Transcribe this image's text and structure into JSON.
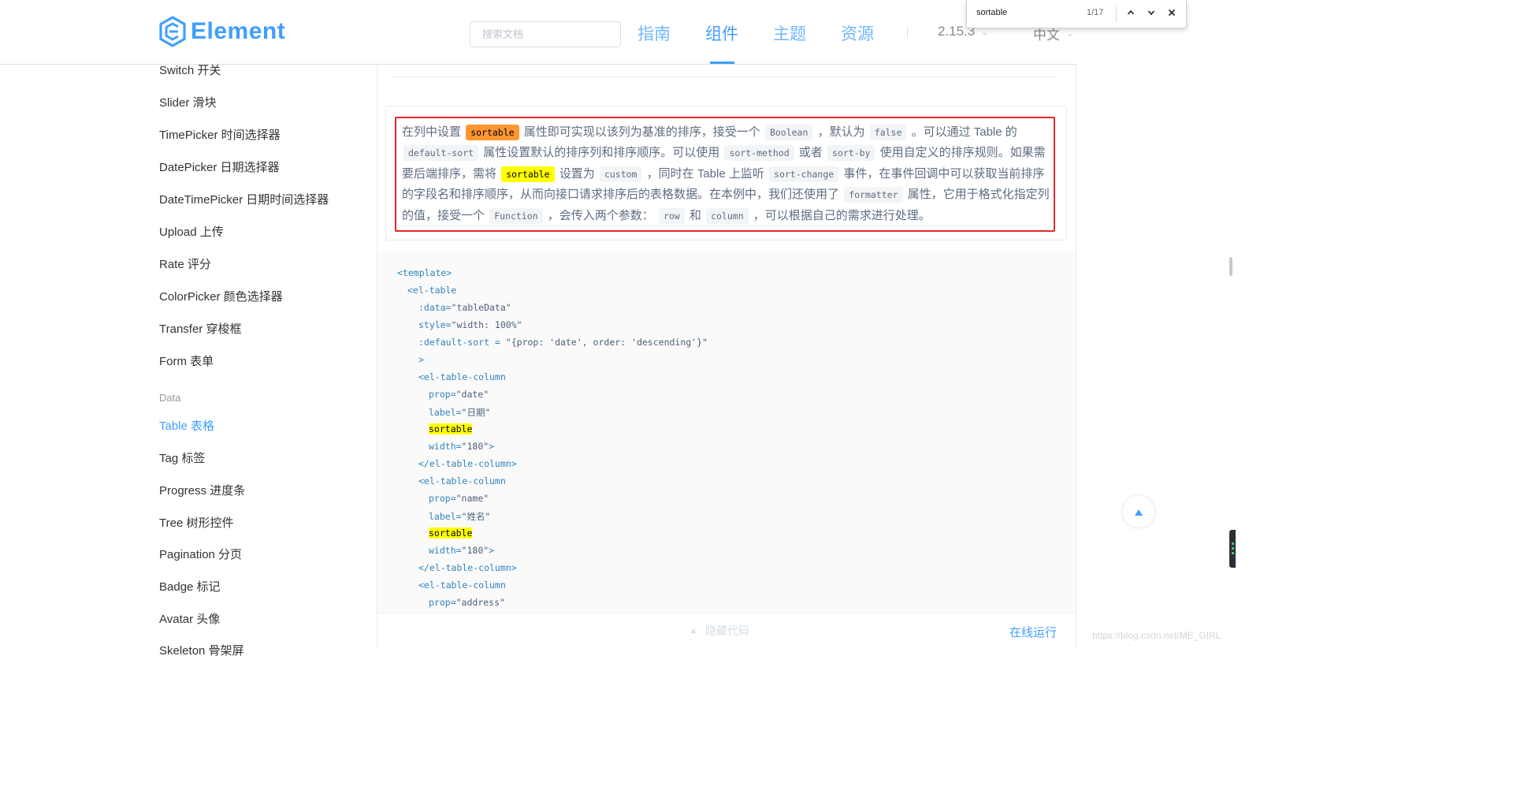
{
  "header": {
    "logo_text": "Element",
    "search_placeholder": "搜索文档",
    "nav": [
      "指南",
      "组件",
      "主题",
      "资源"
    ],
    "version": "2.15.3",
    "language": "中文"
  },
  "find_bar": {
    "query": "sortable",
    "count": "1/17"
  },
  "sidebar": {
    "items_top": [
      "Switch 开关",
      "Slider 滑块",
      "TimePicker 时间选择器",
      "DatePicker 日期选择器",
      "DateTimePicker 日期时间选择器",
      "Upload 上传",
      "Rate 评分",
      "ColorPicker 颜色选择器",
      "Transfer 穿梭框",
      "Form 表单"
    ],
    "group_label": "Data",
    "items_data": [
      "Table 表格",
      "Tag 标签",
      "Progress 进度条",
      "Tree 树形控件",
      "Pagination 分页",
      "Badge 标记",
      "Avatar 头像",
      "Skeleton 骨架屏"
    ],
    "active": "Table 表格"
  },
  "description": {
    "t1": "在列中设置",
    "c1": "sortable",
    "t2": "属性即可实现以该列为基准的排序，接受一个",
    "c2": "Boolean",
    "t3": "，默认为",
    "c3": "false",
    "t4": "。可以通过 Table 的",
    "c4": "default-sort",
    "t5": "属性设置默认的排序列和排序顺序。可以使用",
    "c5": "sort-method",
    "t6": "或者",
    "c6": "sort-by",
    "t7": "使用自定义的排序规则。如果需要后端排序，需将",
    "c7": "sortable",
    "t8": "设置为",
    "c8": "custom",
    "t9": "，同时在 Table 上监听",
    "c9": "sort-change",
    "t10": "事件，在事件回调中可以获取当前排序的字段名和排序顺序，从而向接口请求排序后的表格数据。在本例中，我们还使用了",
    "c10": "formatter",
    "t11": "属性，它用于格式化指定列的值，接受一个",
    "c11": "Function",
    "t12": "，会传入两个参数：",
    "c12": "row",
    "t13": "和",
    "c13": "column",
    "t14": "，可以根据自己的需求进行处理。"
  },
  "code": {
    "l1": "<template>",
    "l2": "<el-table",
    "l3a": ":data=",
    "l3b": "\"tableData\"",
    "l4a": "style=",
    "l4b": "\"width: 100%\"",
    "l5a": ":default-sort = ",
    "l5b": "\"{prop: 'date', order: 'descending'}\"",
    "l6": ">",
    "l7": "<el-table-column",
    "l8a": "prop=",
    "l8b": "\"date\"",
    "l9a": "label=",
    "l9b": "\"日期\"",
    "l10": "sortable",
    "l11a": "width=",
    "l11b": "\"180\"",
    "l11c": ">",
    "l12": "</el-table-column>",
    "l13": "<el-table-column",
    "l14a": "prop=",
    "l14b": "\"name\"",
    "l15a": "label=",
    "l15b": "\"姓名\"",
    "l16": "sortable",
    "l17a": "width=",
    "l17b": "\"180\"",
    "l17c": ">",
    "l18": "</el-table-column>",
    "l19": "<el-table-column",
    "l20a": "prop=",
    "l20b": "\"address\""
  },
  "controls": {
    "hide_code": "隐藏代码",
    "run_online": "在线运行"
  },
  "watermark": "https://blog.csdn.net/ME_GIRL"
}
